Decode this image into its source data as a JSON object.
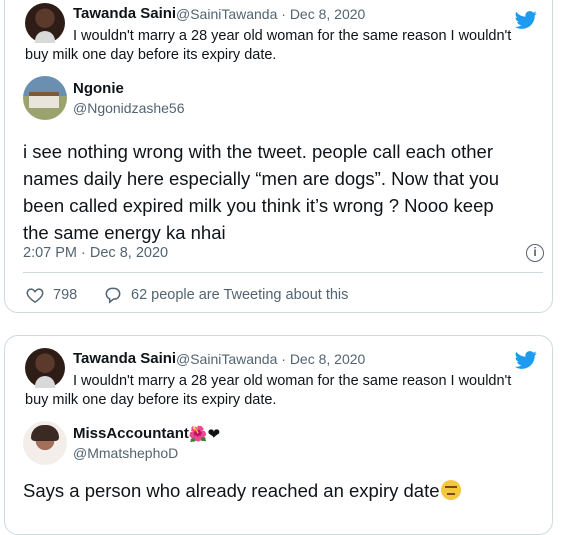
{
  "card1": {
    "quoted": {
      "name": "Tawanda Saini",
      "handle_date": "@SainiTawanda · Dec 8, 2020",
      "text_line1": "I wouldn't marry a 28 year old woman for the same reason I wouldn't",
      "text_line2": "buy milk one day before its expiry date."
    },
    "author": {
      "name": "Ngonie",
      "handle": "@Ngonidzashe56"
    },
    "body_lines": [
      "i see nothing wrong with the tweet. people call each other",
      "names daily here especially “men are dogs”. Now that you",
      "been called expired milk you think it’s wrong ? Nooo keep",
      "the same energy ka nhai"
    ],
    "timestamp": "2:07 PM · Dec 8, 2020",
    "likes": "798",
    "discussion": "62 people are Tweeting about this",
    "info_glyph": "i"
  },
  "card2": {
    "quoted": {
      "name": "Tawanda Saini",
      "handle_date": "@SainiTawanda · Dec 8, 2020",
      "text_line1": "I wouldn't marry a 28 year old woman for the same reason I wouldn't",
      "text_line2": "buy milk one day before its expiry date."
    },
    "author": {
      "name": "MissAccountant",
      "name_emojis": "🌺❤",
      "handle": "@MmatshephoD"
    },
    "body": "Says a person who already reached an expiry date"
  },
  "colors": {
    "twitter_blue": "#1d9bf0",
    "secondary_text": "#536471",
    "border": "#cfd9de"
  },
  "icons": [
    "twitter-bird-icon",
    "info-icon",
    "heart-icon",
    "reply-bubble-icon",
    "unamused-face-emoji"
  ]
}
